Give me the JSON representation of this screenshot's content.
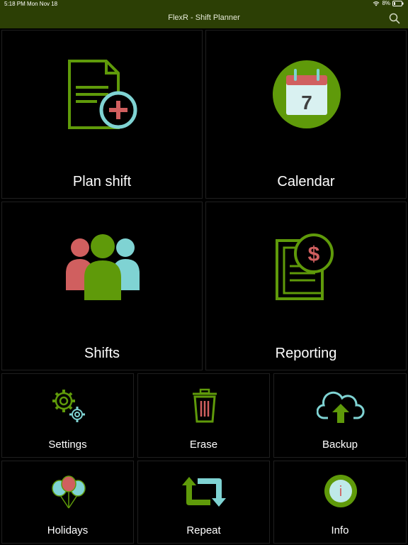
{
  "status_bar": {
    "time": "5:18 PM",
    "date": "Mon Nov 18",
    "battery": "8%"
  },
  "nav": {
    "title": "FlexR - Shift Planner"
  },
  "tiles": {
    "plan_shift": {
      "label": "Plan shift",
      "icon": "add-document-icon"
    },
    "calendar": {
      "label": "Calendar",
      "icon": "calendar-icon",
      "day": "7"
    },
    "shifts": {
      "label": "Shifts",
      "icon": "people-icon"
    },
    "reporting": {
      "label": "Reporting",
      "icon": "report-dollar-icon",
      "symbol": "$"
    },
    "settings": {
      "label": "Settings",
      "icon": "gears-icon"
    },
    "erase": {
      "label": "Erase",
      "icon": "trash-icon"
    },
    "backup": {
      "label": "Backup",
      "icon": "cloud-upload-icon"
    },
    "holidays": {
      "label": "Holidays",
      "icon": "balloons-icon"
    },
    "repeat": {
      "label": "Repeat",
      "icon": "repeat-icon"
    },
    "info": {
      "label": "Info",
      "icon": "info-icon",
      "symbol": "i"
    }
  },
  "colors": {
    "green": "#5f9a0a",
    "teal": "#7fd3d3",
    "red": "#d05f5f",
    "navbar": "#2c3f05"
  }
}
